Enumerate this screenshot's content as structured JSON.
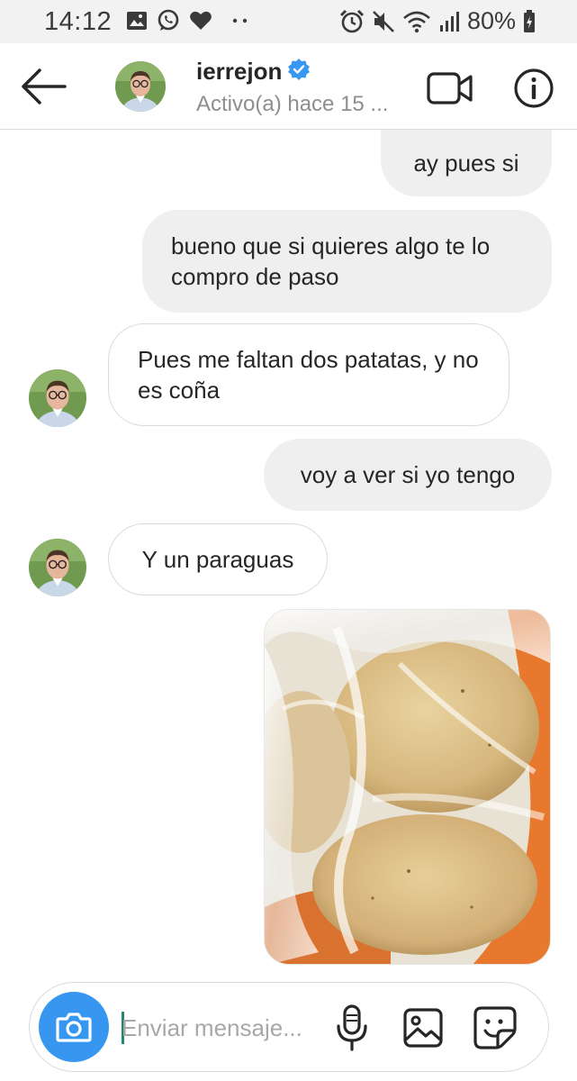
{
  "status_bar": {
    "time": "14:12",
    "battery": "80%",
    "left_icons": [
      "image-icon",
      "whatsapp-icon",
      "heart-icon",
      "more-dots-icon"
    ],
    "right_icons": [
      "alarm-icon",
      "mute-icon",
      "wifi-icon",
      "signal-icon",
      "battery-icon"
    ]
  },
  "header": {
    "username": "ierrejon",
    "verified": true,
    "status": "Activo(a) hace 15 ...",
    "accent_color": "#3897f0"
  },
  "messages": [
    {
      "direction": "outgoing",
      "text": "ay pues si"
    },
    {
      "direction": "outgoing",
      "text": "bueno que si quieres algo te lo compro de paso"
    },
    {
      "direction": "incoming",
      "text": "Pues me faltan dos patatas, y no es coña"
    },
    {
      "direction": "outgoing",
      "text": "voy a ver si yo tengo"
    },
    {
      "direction": "incoming",
      "text": "Y un paraguas"
    },
    {
      "direction": "outgoing",
      "type": "photo",
      "content": "potatoes-in-plastic-bag"
    }
  ],
  "composer": {
    "placeholder": "Enviar mensaje...",
    "camera_button_color": "#3797f0"
  }
}
